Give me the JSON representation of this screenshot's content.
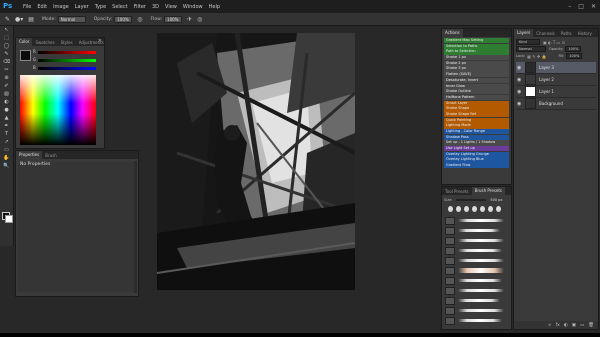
{
  "app": {
    "logo": "Ps"
  },
  "menu": [
    "File",
    "Edit",
    "Image",
    "Layer",
    "Type",
    "Select",
    "Filter",
    "3D",
    "View",
    "Window",
    "Help"
  ],
  "window_controls": [
    "–",
    "□",
    "✕"
  ],
  "options_bar": {
    "mode_label": "Mode:",
    "mode_value": "Normal",
    "opacity_label": "Opacity:",
    "opacity_value": "100%",
    "flow_label": "Flow:",
    "flow_value": "100%"
  },
  "tools": [
    "↖",
    "⬚",
    "◯",
    "✎",
    "⌫",
    "✂",
    "⊕",
    "✐",
    "▧",
    "◐",
    "●",
    "▲",
    "✒",
    "T",
    "↗",
    "▭",
    "✋",
    "🔍"
  ],
  "color_panel": {
    "tabs": [
      "Color",
      "Swatches",
      "Styles",
      "Adjustments"
    ],
    "slider_letters": [
      "R",
      "G",
      "B"
    ],
    "close": "✕"
  },
  "properties_panel": {
    "tabs": [
      "Properties",
      "Brush"
    ],
    "message": "No Properties"
  },
  "actions_panel": {
    "title": "Actions",
    "actions": [
      {
        "label": "Gradient Map Setting",
        "color": "#2e7d32"
      },
      {
        "label": "Selection to Paths",
        "color": "#2e7d32"
      },
      {
        "label": "Path to Selection",
        "color": "#2e7d32"
      },
      {
        "label": "Stroke 1 px",
        "color": "#4a4a4a"
      },
      {
        "label": "Stroke 2 px",
        "color": "#4a4a4a"
      },
      {
        "label": "Stroke 3 px",
        "color": "#4a4a4a"
      },
      {
        "label": "Flatten (SAVE)",
        "color": "#4a4a4a"
      },
      {
        "label": "Desaturate, Invert",
        "color": "#4a4a4a"
      },
      {
        "label": "Inner Glow",
        "color": "#4a4a4a"
      },
      {
        "label": "Stroke Outline",
        "color": "#4a4a4a"
      },
      {
        "label": "Halftone Pattern",
        "color": "#4a4a4a"
      },
      {
        "label": "Smart Layer",
        "color": "#b35a00"
      },
      {
        "label": "Stroke Shape",
        "color": "#b35a00"
      },
      {
        "label": "Stroke Shape Ref",
        "color": "#b35a00"
      },
      {
        "label": "Quick Painting",
        "color": "#b35a00"
      },
      {
        "label": "Lighting Mode",
        "color": "#b35a00"
      },
      {
        "label": "Lighting - Color Range",
        "color": "#1e56a0"
      },
      {
        "label": "Shadow Pass",
        "color": "#1e56a0"
      },
      {
        "label": "Set up - 1 Lights / 1 Shadow",
        "color": "#4a4a4a"
      },
      {
        "label": "Use Light Set up",
        "color": "#6a3d9a"
      },
      {
        "label": "Overlay Lighting Grunge",
        "color": "#1e56a0"
      },
      {
        "label": "Overlay Lighting Blue",
        "color": "#1e56a0"
      },
      {
        "label": "Gradient Flow",
        "color": "#1e56a0"
      }
    ]
  },
  "brush_panel": {
    "tabs": [
      "Tool Presets",
      "Brush Presets"
    ],
    "size_label": "Size:",
    "size_value": "500 px"
  },
  "layers_panel": {
    "tabs": [
      "Layers",
      "Channels",
      "Paths",
      "History"
    ],
    "kind_label": "Kind",
    "blend_mode": "Normal",
    "opacity_label": "Opacity:",
    "opacity_value": "100%",
    "lock_label": "Lock:",
    "fill_label": "Fill:",
    "fill_value": "100%",
    "layers": [
      {
        "name": "Layer 3",
        "selected": true
      },
      {
        "name": "Layer 2",
        "selected": false
      },
      {
        "name": "Layer 1",
        "selected": false
      },
      {
        "name": "Background",
        "selected": false
      }
    ],
    "footer_icons": [
      "∞",
      "fx",
      "◐",
      "▣",
      "▭",
      "🗑"
    ]
  }
}
